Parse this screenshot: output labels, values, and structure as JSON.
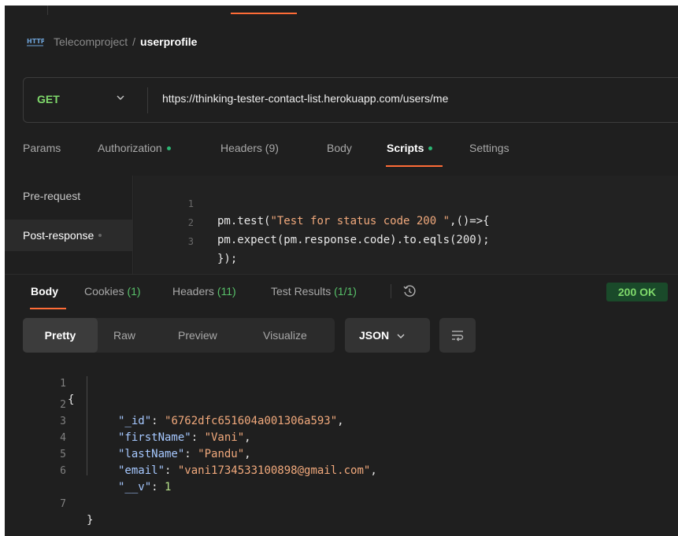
{
  "breadcrumb": {
    "icon": "http-icon",
    "project": "Telecomproject",
    "separator": "/",
    "request": "userprofile"
  },
  "request": {
    "method": "GET",
    "url": "https://thinking-tester-contact-list.herokuapp.com/users/me"
  },
  "request_tabs": [
    {
      "label": "Params"
    },
    {
      "label": "Authorization"
    },
    {
      "label": "Headers (9)"
    },
    {
      "label": "Body"
    },
    {
      "label": "Scripts"
    },
    {
      "label": "Settings"
    }
  ],
  "scripts": {
    "side": [
      {
        "label": "Pre-request"
      },
      {
        "label": "Post-response"
      }
    ],
    "lines": [
      {
        "n": "1",
        "pre": "pm.test(",
        "str": "\"Test for status code 200 \"",
        "post": ",()=>{"
      },
      {
        "n": "2",
        "pre": "pm.expect(pm.response.code).to.eqls(200);",
        "str": "",
        "post": ""
      },
      {
        "n": "3",
        "pre": "});",
        "str": "",
        "post": ""
      }
    ]
  },
  "response_tabs": {
    "body": "Body",
    "cookies": "Cookies",
    "cookies_count": "(1)",
    "headers": "Headers",
    "headers_count": "(11)",
    "tests": "Test Results",
    "tests_count": "(1/1)"
  },
  "status": "200 OK",
  "views": [
    {
      "label": "Pretty"
    },
    {
      "label": "Raw"
    },
    {
      "label": "Preview"
    },
    {
      "label": "Visualize"
    }
  ],
  "format": "JSON",
  "response_lines": [
    {
      "n": "1",
      "text": "{"
    },
    {
      "n": "2",
      "key": "\"_id\"",
      "value": "\"6762dfc651604a001306a593\"",
      "type": "string",
      "trail": ","
    },
    {
      "n": "3",
      "key": "\"firstName\"",
      "value": "\"Vani\"",
      "type": "string",
      "trail": ","
    },
    {
      "n": "4",
      "key": "\"lastName\"",
      "value": "\"Pandu\"",
      "type": "string",
      "trail": ","
    },
    {
      "n": "5",
      "key": "\"email\"",
      "value": "\"vani1734533100898@gmail.com\"",
      "type": "string",
      "trail": ","
    },
    {
      "n": "6",
      "key": "\"__v\"",
      "value": "1",
      "type": "number",
      "trail": ""
    },
    {
      "n": "7",
      "text": "}"
    }
  ],
  "colors": {
    "accent": "#ff6c37",
    "success": "#2bb673",
    "method_get": "#7fd96b"
  }
}
